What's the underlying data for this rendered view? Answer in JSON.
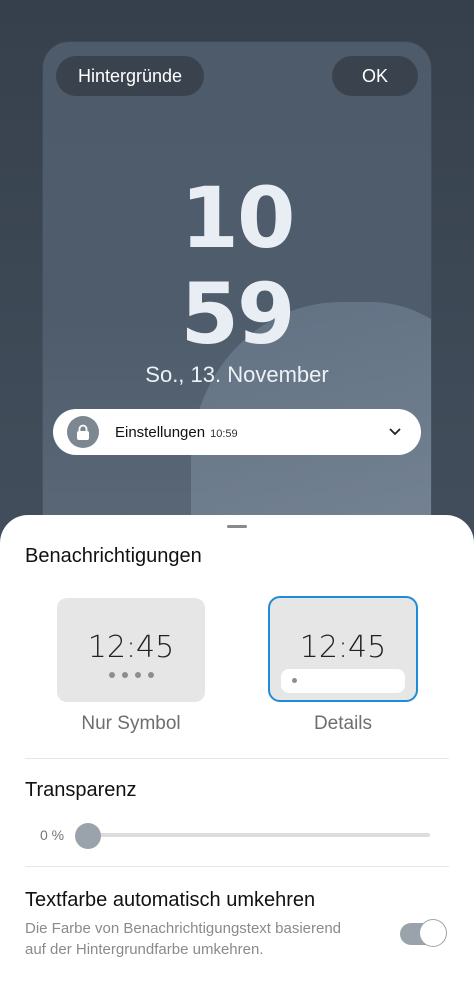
{
  "preview": {
    "wallpapers_button": "Hintergründe",
    "ok_button": "OK",
    "clock_hour": "10",
    "clock_minute": "59",
    "date": "So., 13. November",
    "notification": {
      "title": "Einstellungen",
      "time": "10:59",
      "icon": "lock-icon"
    }
  },
  "sheet": {
    "title": "Benachrichtigungen",
    "options": [
      {
        "time": "12:45",
        "label": "Nur Symbol",
        "selected": false
      },
      {
        "time": "12:45",
        "label": "Details",
        "selected": true
      }
    ],
    "transparency": {
      "title": "Transparenz",
      "value_label": "0 %",
      "value_percent": 0
    },
    "invert_text_color": {
      "title": "Textfarbe automatisch umkehren",
      "description": "Die Farbe von Benachrichtigungstext basierend auf der Hintergrundfarbe umkehren.",
      "enabled": true
    }
  },
  "colors": {
    "accent_selected": "#1f8cd8",
    "toggle_track": "#9aa3ac"
  }
}
